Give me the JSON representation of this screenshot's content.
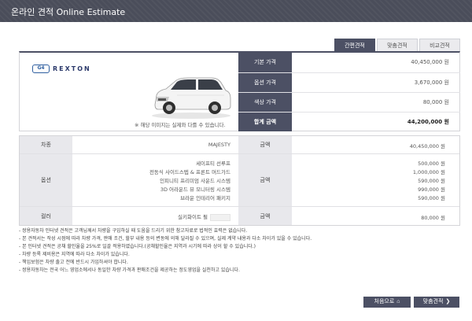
{
  "window": {
    "title": "온라인 견적 Online Estimate"
  },
  "tabs": [
    {
      "label": "간편견적",
      "active": true
    },
    {
      "label": "맞춤견적",
      "active": false
    },
    {
      "label": "비교견적",
      "active": false
    }
  ],
  "vehicle": {
    "logo_badge": "G4",
    "logo_word": "REXTON",
    "image_note": "※ 해당 이미지는 실제와 다를 수 있습니다."
  },
  "summary": [
    {
      "label": "기본 가격",
      "value": "40,450,000 원"
    },
    {
      "label": "옵션 가격",
      "value": "3,670,000 원"
    },
    {
      "label": "색상 가격",
      "value": "80,000 원"
    },
    {
      "label": "합계 금액",
      "value": "44,200,000 원"
    }
  ],
  "detail": {
    "trim": {
      "label": "차종",
      "name": "MAJESTY",
      "amount_label": "금액",
      "amount": "40,450,000 원"
    },
    "options": {
      "label": "옵션",
      "amount_label": "금액",
      "items": [
        {
          "name": "세이프티 선루프",
          "price": "500,000 원"
        },
        {
          "name": "전동식 사이드스텝 & 프론트 머드가드",
          "price": "1,000,000 원"
        },
        {
          "name": "인피니티 프리미엄 사운드 시스템",
          "price": "590,000 원"
        },
        {
          "name": "3D 어라운드 뷰 모니터링 시스템",
          "price": "990,000 원"
        },
        {
          "name": "브라운 인테리어 패키지",
          "price": "590,000 원"
        }
      ]
    },
    "color": {
      "label": "컬러",
      "name": "실키화이트 펄",
      "amount_label": "금액",
      "amount": "80,000 원"
    }
  },
  "notes": [
    "- 쌍용자동차 인터넷 견적은 고객님께서 차량을 구입하실 때 도움을 드리기 위한 참고자료로 법적인 효력은 없습니다.",
    "- 본 견적서는 작성 시점에 따라 차량 가격, 판매 조건, 할부 내용 등의 변동에 의해 달라질 수 있으며, 실제 계약 내용과 다소 차이가 있을 수 있습니다.",
    "- 본 인터넷 견적은 공채 할인율을 25%로 일괄 적용하였습니다.(공채할인율은 지역과 시기에 따라 상이 할 수 있습니다.)",
    "- 차량 등록 제비용은 지역에 따라 다소 차이가 있습니다.",
    "- 책임보험은 차량 출고 전에 반드시 가입하셔야 합니다.",
    "- 쌍용자동차는 전국 어느 영업소에서나 동일한 차량 가격과 판매조건을 제공하는 정도영업을 실천하고 있습니다."
  ],
  "buttons": {
    "home": {
      "label": "처음으로",
      "icon": "home-icon"
    },
    "custom": {
      "label": "맞춤견적",
      "icon": "chevron-right-icon"
    }
  },
  "colors": {
    "accent": "#4c5064",
    "titlebar": "#4a4d5a",
    "cell_bg": "#e8e8ec"
  }
}
